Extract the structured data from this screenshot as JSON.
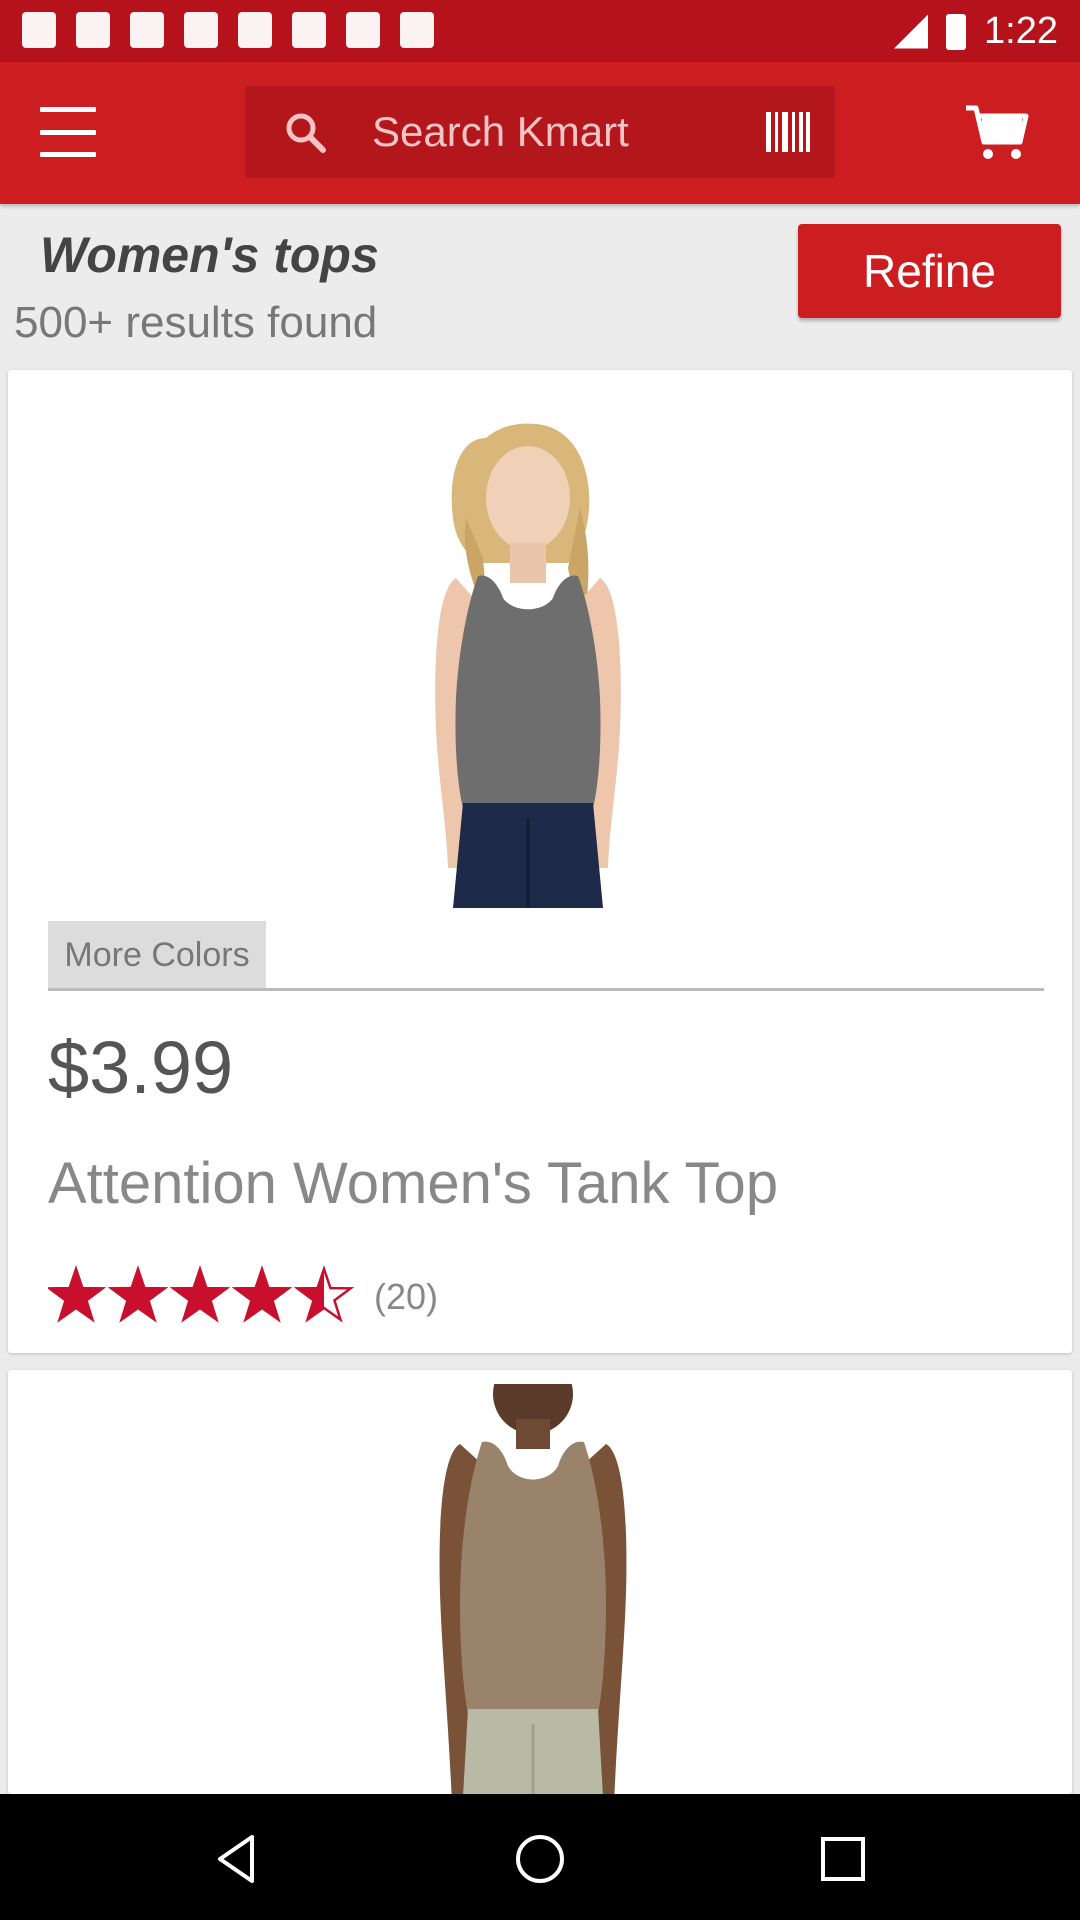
{
  "status_bar": {
    "time": "1:22",
    "icons": [
      "flipboard-icon",
      "sim-icon",
      "flipboard-icon",
      "satellite-icon",
      "lock-icon",
      "cloud-icon",
      "mailbox-icon",
      "play-store-icon",
      "signal-icon",
      "battery-icon"
    ]
  },
  "app_bar": {
    "menu_icon": "hamburger-menu-icon",
    "search": {
      "placeholder": "Search Kmart",
      "search_icon": "search-icon",
      "scan_icon": "barcode-scan-icon"
    },
    "cart_icon": "shopping-cart-icon"
  },
  "header": {
    "category": "Women's tops",
    "results": "500+ results found",
    "refine_label": "Refine"
  },
  "products": [
    {
      "image_desc": "woman in grey tank top",
      "more_colors": "More Colors",
      "price": "$3.99",
      "name": "Attention Women's Tank Top",
      "rating": 4.5,
      "rating_max": 5,
      "reviews": "(20)"
    },
    {
      "image_desc": "woman in taupe tank top"
    }
  ],
  "colors": {
    "brand_red": "#cc1d21",
    "status_red": "#b5121b",
    "star_red": "#c8102e"
  },
  "nav_bar": {
    "icons": [
      "back-icon",
      "home-icon",
      "recents-icon"
    ]
  }
}
